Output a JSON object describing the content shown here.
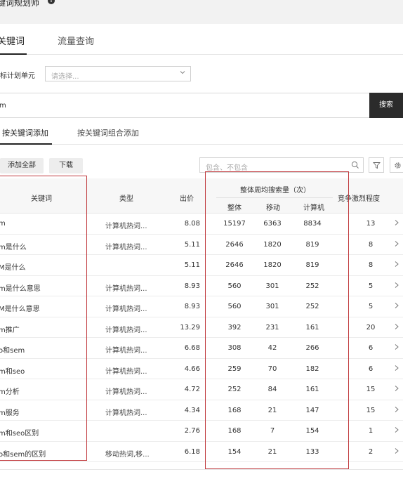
{
  "app": {
    "title": "键词规划师",
    "info_glyph": "!"
  },
  "tabs": [
    {
      "label": "关键词"
    },
    {
      "label": "流量查询"
    }
  ],
  "plan": {
    "label": "标计划单元",
    "placeholder": "请选择..."
  },
  "search": {
    "value": "m",
    "button_label": "搜索"
  },
  "subtabs": [
    {
      "label": "按关键词添加"
    },
    {
      "label": "按关键词组合添加"
    }
  ],
  "toolbar": {
    "add_all_label": "添加全部",
    "download_label": "下载",
    "filter_placeholder": "包含、不包含"
  },
  "table": {
    "headers": {
      "keyword": "关键词",
      "type": "类型",
      "bid": "出价",
      "volume_group": "整体周均搜索量（次）",
      "volume_all": "整体",
      "volume_mobile": "移动",
      "volume_pc": "计算机",
      "competition": "竞争激烈程度"
    },
    "rows": [
      {
        "keyword": "m",
        "type": "计算机热词...",
        "bid": "8.08",
        "all": "15197",
        "mobile": "6363",
        "pc": "8834",
        "competition": "13"
      },
      {
        "keyword": "m是什么",
        "type": "计算机热词...",
        "bid": "5.11",
        "all": "2646",
        "mobile": "1820",
        "pc": "819",
        "competition": "8"
      },
      {
        "keyword": "M是什么",
        "type": "",
        "bid": "5.11",
        "all": "2646",
        "mobile": "1820",
        "pc": "819",
        "competition": "8"
      },
      {
        "keyword": "m是什么意思",
        "type": "计算机热词...",
        "bid": "8.93",
        "all": "560",
        "mobile": "301",
        "pc": "252",
        "competition": "5"
      },
      {
        "keyword": "M是什么意思",
        "type": "计算机热词...",
        "bid": "8.93",
        "all": "560",
        "mobile": "301",
        "pc": "252",
        "competition": "5"
      },
      {
        "keyword": "m推广",
        "type": "计算机热词...",
        "bid": "13.29",
        "all": "392",
        "mobile": "231",
        "pc": "161",
        "competition": "20"
      },
      {
        "keyword": "o和sem",
        "type": "计算机热词...",
        "bid": "6.68",
        "all": "308",
        "mobile": "42",
        "pc": "266",
        "competition": "6"
      },
      {
        "keyword": "m和seo",
        "type": "计算机热词...",
        "bid": "4.66",
        "all": "259",
        "mobile": "70",
        "pc": "182",
        "competition": "6"
      },
      {
        "keyword": "m分析",
        "type": "计算机热词...",
        "bid": "4.72",
        "all": "252",
        "mobile": "84",
        "pc": "161",
        "competition": "15"
      },
      {
        "keyword": "m服务",
        "type": "计算机热词...",
        "bid": "4.34",
        "all": "168",
        "mobile": "21",
        "pc": "147",
        "competition": "15"
      },
      {
        "keyword": "m和seo区别",
        "type": "",
        "bid": "2.76",
        "all": "168",
        "mobile": "7",
        "pc": "154",
        "competition": "1"
      },
      {
        "keyword": "o和sem的区别",
        "type": "移动热词,移...",
        "bid": "6.18",
        "all": "154",
        "mobile": "21",
        "pc": "133",
        "competition": "2"
      }
    ]
  },
  "colors": {
    "highlight_box": "#c0383c",
    "search_button": "#2b2b2b",
    "header_bg": "#f7f7f7"
  }
}
